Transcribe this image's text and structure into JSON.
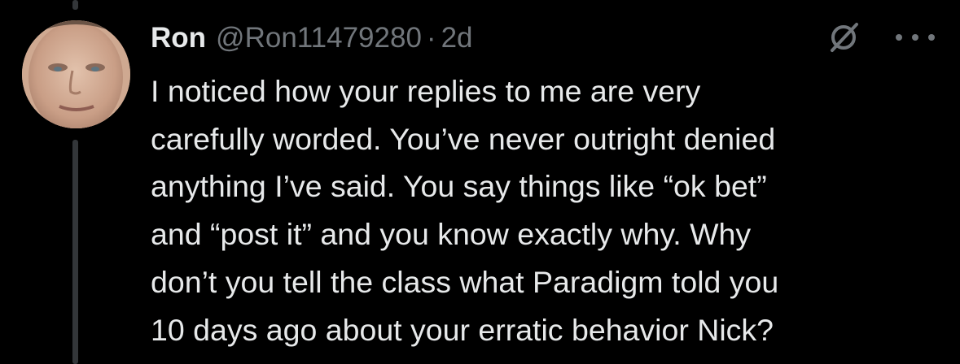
{
  "tweet": {
    "author_name": "Ron",
    "author_handle": "@Ron11479280",
    "separator": "·",
    "timestamp": "2d",
    "text": "I noticed how your replies to me are very\ncarefully worded. You’ve never outright denied\nanything I’ve said. You say things like “ok bet”\nand “post it” and you know exactly why. Why\ndon’t you tell the class what Paradigm told you\n10 days ago about your erratic behavior Nick?"
  },
  "icons": {
    "grok": "grok-icon",
    "more": "more-icon",
    "avatar": "avatar"
  },
  "colors": {
    "background": "#000000",
    "primary_text": "#e7e9ea",
    "secondary_text": "#71767b",
    "thread_line": "#333639"
  }
}
